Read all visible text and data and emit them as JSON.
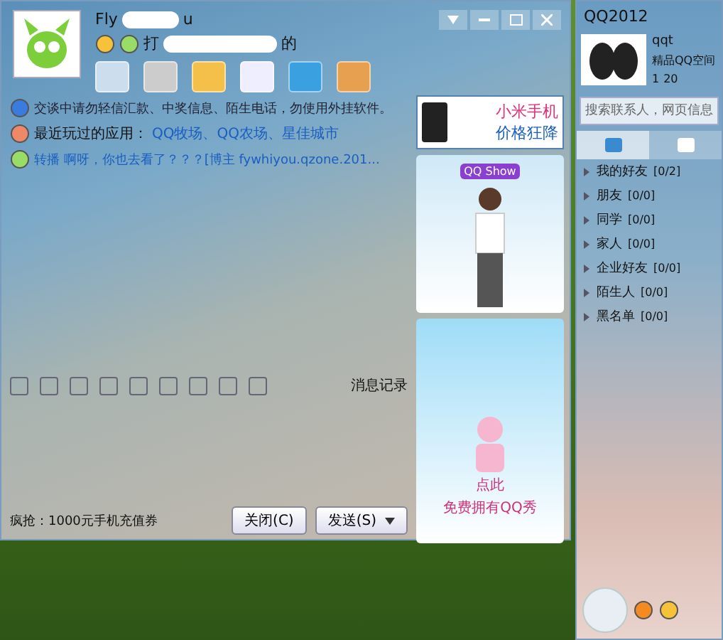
{
  "chat_window": {
    "contact_name_start": "Fly",
    "contact_name_end": "u",
    "signature_start": "打",
    "signature_end": "的",
    "notice": "交谈中请勿轻信汇款、中奖信息、陌生电话，勿使用外挂软件。",
    "recent_apps_label": "最近玩过的应用：",
    "recent_apps": "QQ牧场、QQ农场、星佳城市",
    "feed": "转播 啊呀，你也去看了？？？[博主 fywhiyou.qzone.201...",
    "history_button": "消息记录",
    "promo": "疯抢：1000元手机充值券",
    "buttons": [
      {
        "label": "关闭(C)",
        "kind": "plain"
      },
      {
        "label": "发送(S)",
        "kind": "split"
      }
    ],
    "ad": {
      "line1": "小米手机",
      "line2": "价格狂降"
    },
    "show_badge": "QQ Show",
    "show_cta": [
      "点此",
      "免费拥有QQ秀"
    ]
  },
  "main_panel": {
    "title": "QQ2012",
    "nickname": "qqt",
    "signature": "精品QQ空间",
    "level": "1",
    "points": "20",
    "search": {
      "placeholder": "搜索联系人，网页信息"
    },
    "tabs": [
      {
        "selected": true
      },
      {
        "selected": false
      }
    ],
    "groups": [
      {
        "label": "我的好友",
        "count": "[0/2]",
        "expanded": false
      },
      {
        "label": "朋友",
        "count": "[0/0]",
        "expanded": false
      },
      {
        "label": "同学",
        "count": "[0/0]",
        "expanded": false
      },
      {
        "label": "家人",
        "count": "[0/0]",
        "expanded": false
      },
      {
        "label": "企业好友",
        "count": "[0/0]",
        "expanded": false
      },
      {
        "label": "陌生人",
        "count": "[0/0]",
        "expanded": false
      },
      {
        "label": "黑名单",
        "count": "[0/0]",
        "expanded": false
      }
    ]
  }
}
